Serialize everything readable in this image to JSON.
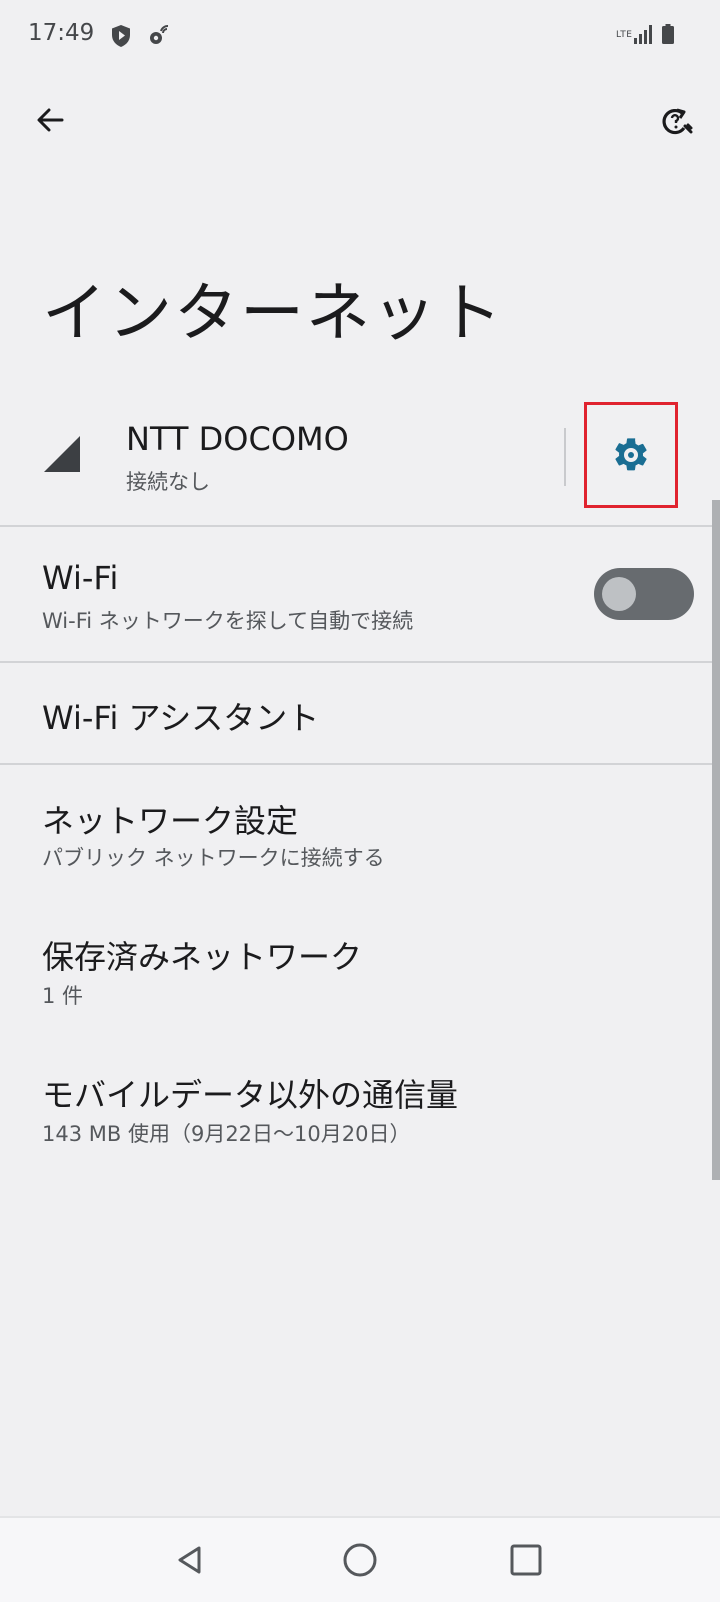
{
  "status_bar": {
    "time": "17:49",
    "network_type": "LTE",
    "icons": [
      "shield-icon",
      "gear-icon",
      "signal-icon",
      "battery-icon"
    ]
  },
  "toolbar": {
    "back_icon": "arrow-left-icon",
    "help_icon": "help-refresh-icon"
  },
  "page": {
    "title": "インターネット"
  },
  "carrier": {
    "name": "NTT DOCOMO",
    "status": "接続なし",
    "settings_icon": "gear-icon",
    "highlight_color": "#e0232f",
    "icon_color": "#1a6e93"
  },
  "wifi": {
    "title": "Wi-Fi",
    "summary": "Wi-Fi ネットワークを探して自動で接続",
    "toggle_on": false
  },
  "wifi_assistant": {
    "title": "Wi-Fi アシスタント"
  },
  "network_settings": {
    "title": "ネットワーク設定",
    "summary": "パブリック ネットワークに接続する"
  },
  "saved_networks": {
    "title": "保存済みネットワーク",
    "summary": "1 件"
  },
  "non_mobile_data": {
    "title": "モバイルデータ以外の通信量",
    "summary": "143 MB 使用（9月22日〜10月20日）"
  },
  "nav_bar": {
    "icons": [
      "nav-back-icon",
      "nav-home-icon",
      "nav-recents-icon"
    ]
  }
}
